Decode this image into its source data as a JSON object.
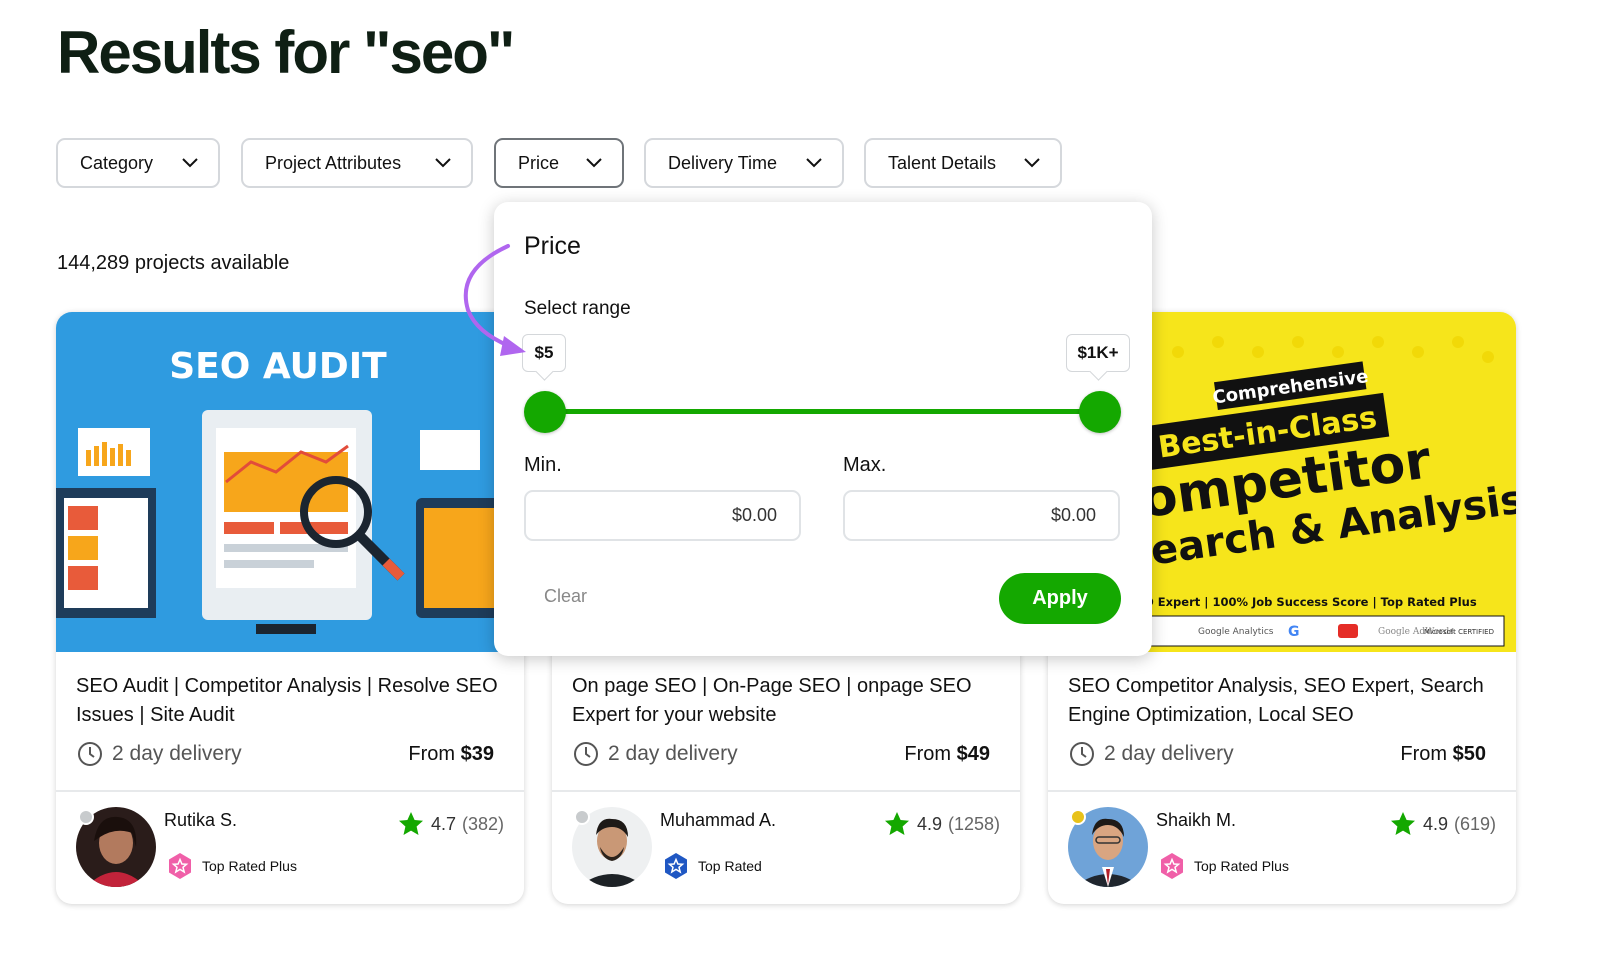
{
  "page": {
    "title": "Results for \"seo\""
  },
  "filters": [
    {
      "label": "Category"
    },
    {
      "label": "Project Attributes"
    },
    {
      "label": "Price"
    },
    {
      "label": "Delivery Time"
    },
    {
      "label": "Talent Details"
    }
  ],
  "results": {
    "count_text": "144,289 projects available"
  },
  "price_popup": {
    "title": "Price",
    "range_label": "Select range",
    "min_tip": "$5",
    "max_tip": "$1K+",
    "min_label": "Min.",
    "max_label": "Max.",
    "min_value": "$0.00",
    "max_value": "$0.00",
    "clear_label": "Clear",
    "apply_label": "Apply"
  },
  "cards": [
    {
      "thumb_text": "SEO AUDIT",
      "title": "SEO Audit | Competitor Analysis | Resolve SEO Issues | Site Audit",
      "delivery": "2 day delivery",
      "price_prefix": "From ",
      "price": "$39",
      "seller": "Rutika S.",
      "badge": "Top Rated Plus",
      "rating": "4.7",
      "reviews": "(382)",
      "status_color": "#c8cbcd"
    },
    {
      "title": "On page SEO | On-Page SEO | onpage SEO Expert for your website",
      "delivery": "2 day delivery",
      "price_prefix": "From ",
      "price": "$49",
      "seller": "Muhammad A.",
      "badge": "Top Rated",
      "rating": "4.9",
      "reviews": "(1258)",
      "status_color": "#c8cbcd"
    },
    {
      "thumb_lines": [
        "Comprehensive",
        "Best-in-Class",
        "ompetitor",
        "earch & Analysis"
      ],
      "thumb_footer": "O Expert | 100% Job Success Score | Top Rated Plus",
      "thumb_logos": [
        "Google Analytics",
        "G",
        "Google AdWords",
        "Microsoft CERTIFIED"
      ],
      "title": "SEO Competitor Analysis, SEO Expert, Search Engine Optimization, Local SEO",
      "delivery": "2 day delivery",
      "price_prefix": "From ",
      "price": "$50",
      "seller": "Shaikh M.",
      "badge": "Top Rated Plus",
      "rating": "4.9",
      "reviews": "(619)",
      "status_color": "#e8c21a"
    }
  ],
  "colors": {
    "accent_green": "#14a800",
    "annotation_purple": "#b066ef",
    "seo_audit_bg": "#2f9be0",
    "competitor_bg": "#f6e51b"
  }
}
